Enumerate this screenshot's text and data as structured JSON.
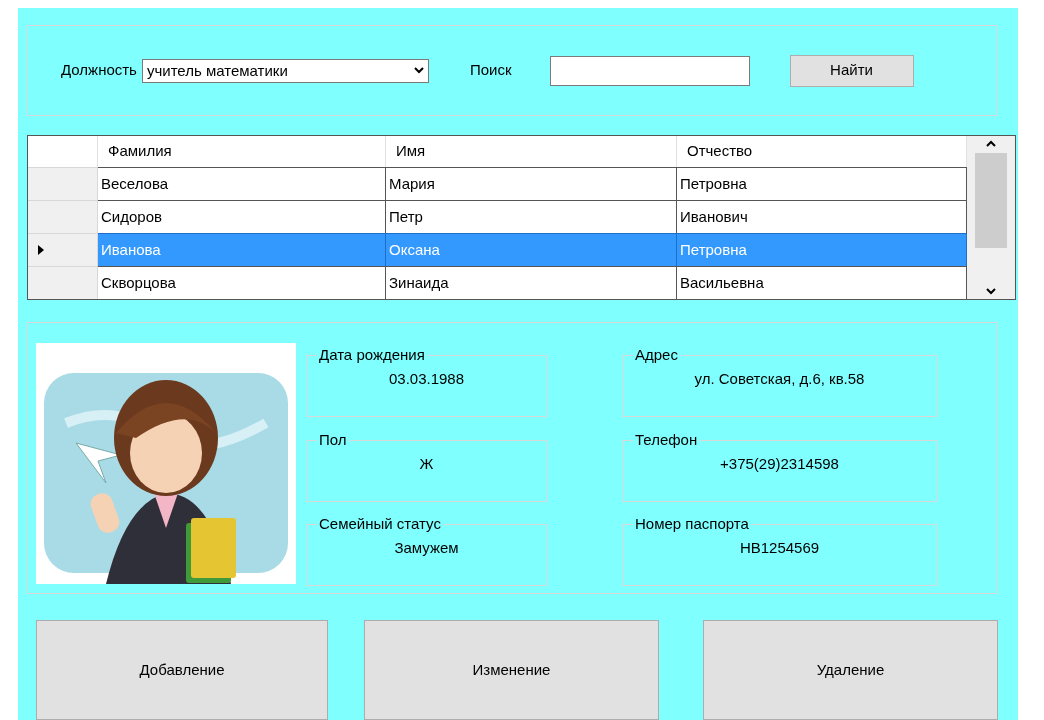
{
  "filter": {
    "position_label": "Должность",
    "position_value": "учитель математики",
    "search_label": "Поиск",
    "find_button": "Найти"
  },
  "table": {
    "columns": [
      "Фамилия",
      "Имя",
      "Отчество"
    ],
    "rows": [
      {
        "cells": [
          "Веселова",
          "Мария",
          "Петровна"
        ],
        "selected": false
      },
      {
        "cells": [
          "Сидоров",
          "Петр",
          "Иванович"
        ],
        "selected": false
      },
      {
        "cells": [
          "Иванова",
          "Оксана",
          "Петровна"
        ],
        "selected": true
      },
      {
        "cells": [
          "Скворцова",
          "Зинаида",
          "Васильевна"
        ],
        "selected": false
      }
    ]
  },
  "details": {
    "groups": [
      {
        "label": "Дата рождения",
        "value": "03.03.1988"
      },
      {
        "label": "Адрес",
        "value": "ул. Советская, д.6, кв.58"
      },
      {
        "label": "Пол",
        "value": "Ж"
      },
      {
        "label": "Телефон",
        "value": "+375(29)2314598"
      },
      {
        "label": "Семейный статус",
        "value": "Замужем"
      },
      {
        "label": "Номер паспорта",
        "value": "НВ1254569"
      }
    ]
  },
  "buttons": [
    "Добавление",
    "Изменение",
    "Удаление"
  ]
}
